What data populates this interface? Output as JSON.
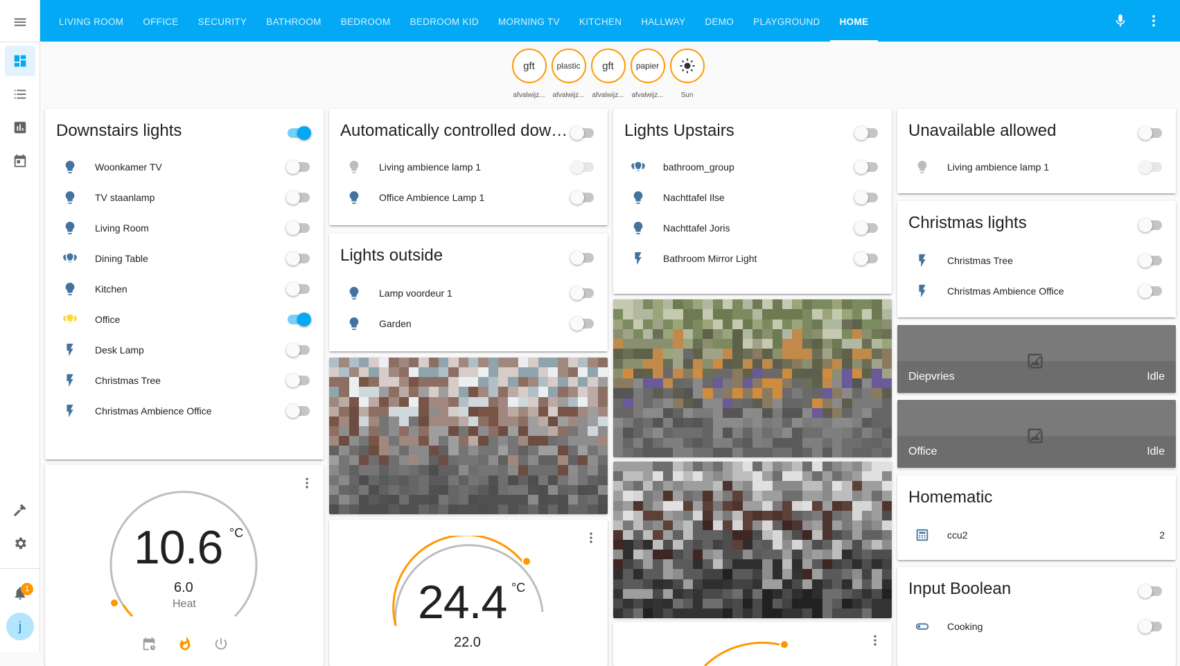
{
  "tabs": [
    "LIVING ROOM",
    "OFFICE",
    "SECURITY",
    "BATHROOM",
    "BEDROOM",
    "BEDROOM KID",
    "MORNING TV",
    "KITCHEN",
    "HALLWAY",
    "DEMO",
    "PLAYGROUND",
    "HOME"
  ],
  "active_tab": "HOME",
  "sidebar": {
    "items": [
      "menu-icon",
      "dashboard-icon",
      "logbook-icon",
      "history-icon",
      "calendar-icon",
      "developer-tools-icon",
      "settings-icon",
      "notifications-icon"
    ],
    "notification_count": "1",
    "avatar_initial": "j"
  },
  "badges": [
    {
      "value": "gft",
      "label": "afvalwijz..."
    },
    {
      "value": "plastic",
      "label": "afvalwijz..."
    },
    {
      "value": "gft",
      "label": "afvalwijz..."
    },
    {
      "value": "papier",
      "label": "afvalwijz..."
    },
    {
      "value": "",
      "label": "Sun",
      "icon": "sun-icon"
    }
  ],
  "downstairs": {
    "title": "Downstairs lights",
    "header_on": true,
    "rows": [
      {
        "label": "Woonkamer TV",
        "icon": "bulb",
        "on": false
      },
      {
        "label": "TV staanlamp",
        "icon": "bulb",
        "on": false
      },
      {
        "label": "Living Room",
        "icon": "bulb",
        "on": false
      },
      {
        "label": "Dining Table",
        "icon": "group",
        "on": false
      },
      {
        "label": "Kitchen",
        "icon": "bulb",
        "on": false
      },
      {
        "label": "Office",
        "icon": "group",
        "on": true
      },
      {
        "label": "Desk Lamp",
        "icon": "flash",
        "on": false
      },
      {
        "label": "Christmas Tree",
        "icon": "flash",
        "on": false
      },
      {
        "label": "Christmas Ambience Office",
        "icon": "flash",
        "on": false
      }
    ]
  },
  "auto_down": {
    "title": "Automatically controlled down...",
    "rows": [
      {
        "label": "Living ambience lamp 1",
        "icon": "bulb",
        "disabled": true
      },
      {
        "label": "Office Ambience Lamp 1",
        "icon": "bulb",
        "disabled": false
      }
    ]
  },
  "outside": {
    "title": "Lights outside",
    "rows": [
      {
        "label": "Lamp voordeur 1",
        "icon": "bulb"
      },
      {
        "label": "Garden",
        "icon": "bulb"
      }
    ]
  },
  "upstairs": {
    "title": "Lights Upstairs",
    "rows": [
      {
        "label": "bathroom_group",
        "icon": "group"
      },
      {
        "label": "Nachttafel Ilse",
        "icon": "bulb"
      },
      {
        "label": "Nachttafel Joris",
        "icon": "bulb"
      },
      {
        "label": "Bathroom Mirror Light",
        "icon": "flash"
      }
    ]
  },
  "unavailable": {
    "title": "Unavailable allowed",
    "rows": [
      {
        "label": "Living ambience lamp 1",
        "icon": "bulb"
      }
    ]
  },
  "christmas": {
    "title": "Christmas lights",
    "rows": [
      {
        "label": "Christmas Tree",
        "icon": "flash"
      },
      {
        "label": "Christmas Ambience Office",
        "icon": "flash"
      }
    ]
  },
  "sensors": [
    {
      "name": "Diepvries",
      "state": "Idle"
    },
    {
      "name": "Office",
      "state": "Idle"
    }
  ],
  "homematic": {
    "title": "Homematic",
    "row_label": "ccu2",
    "row_value": "2"
  },
  "input_boolean": {
    "title": "Input Boolean",
    "row_label": "Cooking"
  },
  "thermostat1": {
    "current": "10.6",
    "unit": "°C",
    "target": "6.0",
    "mode": "Heat"
  },
  "thermostat2": {
    "current": "24.4",
    "unit": "°C",
    "target": "22.0"
  },
  "colors": {
    "primary": "#03a9f4",
    "accent": "#ff9800",
    "icon": "#44739e",
    "light_on": "#fdd835"
  }
}
